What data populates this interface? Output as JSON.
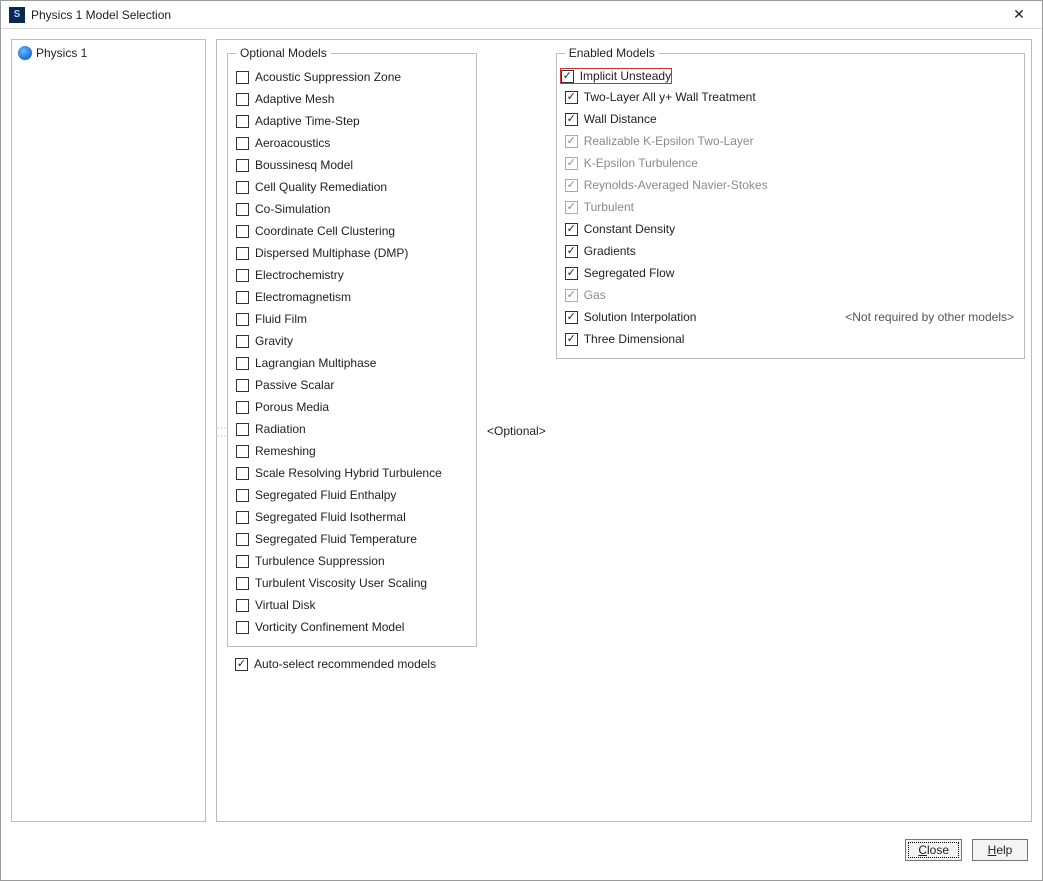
{
  "window": {
    "title": "Physics 1 Model Selection"
  },
  "tree": {
    "item0": "Physics 1"
  },
  "groups": {
    "optional_legend": "Optional Models",
    "enabled_legend": "Enabled Models",
    "middle_tag": "<Optional>"
  },
  "optional_models": [
    "Acoustic Suppression Zone",
    "Adaptive Mesh",
    "Adaptive Time-Step",
    "Aeroacoustics",
    "Boussinesq Model",
    "Cell Quality Remediation",
    "Co-Simulation",
    "Coordinate Cell Clustering",
    "Dispersed Multiphase (DMP)",
    "Electrochemistry",
    "Electromagnetism",
    "Fluid Film",
    "Gravity",
    "Lagrangian Multiphase",
    "Passive Scalar",
    "Porous Media",
    "Radiation",
    "Remeshing",
    "Scale Resolving Hybrid Turbulence",
    "Segregated Fluid Enthalpy",
    "Segregated Fluid Isothermal",
    "Segregated Fluid Temperature",
    "Turbulence Suppression",
    "Turbulent Viscosity User Scaling",
    "Virtual Disk",
    "Vorticity Confinement Model"
  ],
  "enabled_models": [
    {
      "label": "Implicit Unsteady",
      "checked": true,
      "disabled": false,
      "highlight": true,
      "note": ""
    },
    {
      "label": "Two-Layer All y+ Wall Treatment",
      "checked": true,
      "disabled": false,
      "highlight": false,
      "note": ""
    },
    {
      "label": "Wall Distance",
      "checked": true,
      "disabled": false,
      "highlight": false,
      "note": ""
    },
    {
      "label": "Realizable K-Epsilon Two-Layer",
      "checked": true,
      "disabled": true,
      "highlight": false,
      "note": ""
    },
    {
      "label": "K-Epsilon Turbulence",
      "checked": true,
      "disabled": true,
      "highlight": false,
      "note": ""
    },
    {
      "label": "Reynolds-Averaged Navier-Stokes",
      "checked": true,
      "disabled": true,
      "highlight": false,
      "note": ""
    },
    {
      "label": "Turbulent",
      "checked": true,
      "disabled": true,
      "highlight": false,
      "note": ""
    },
    {
      "label": "Constant Density",
      "checked": true,
      "disabled": false,
      "highlight": false,
      "note": ""
    },
    {
      "label": "Gradients",
      "checked": true,
      "disabled": false,
      "highlight": false,
      "note": ""
    },
    {
      "label": "Segregated Flow",
      "checked": true,
      "disabled": false,
      "highlight": false,
      "note": ""
    },
    {
      "label": "Gas",
      "checked": true,
      "disabled": true,
      "highlight": false,
      "note": ""
    },
    {
      "label": "Solution Interpolation",
      "checked": true,
      "disabled": false,
      "highlight": false,
      "note": "<Not required by other models>"
    },
    {
      "label": "Three Dimensional",
      "checked": true,
      "disabled": false,
      "highlight": false,
      "note": ""
    }
  ],
  "auto_select": {
    "label": "Auto-select recommended models",
    "checked": true
  },
  "buttons": {
    "close": "Close",
    "help": "Help"
  }
}
